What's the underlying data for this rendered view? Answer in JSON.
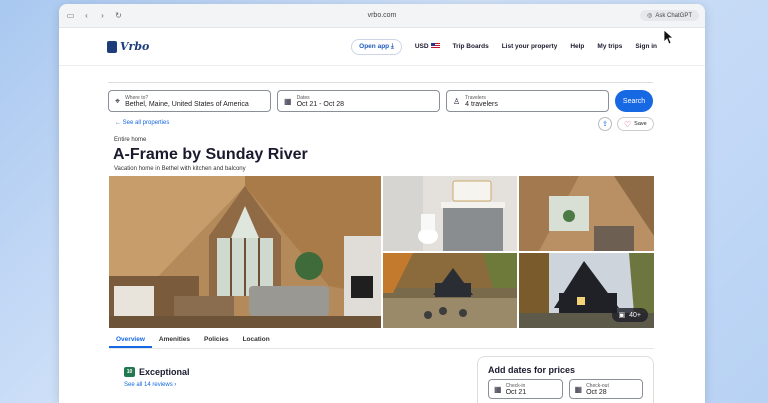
{
  "browser": {
    "url": "vrbo.com",
    "tab_title": "A-Frame by Sunday River",
    "ask_chatgpt": "Ask ChatGPT"
  },
  "nav": {
    "logo": "Vrbo",
    "open_app": "Open app",
    "currency": "USD",
    "trip_boards": "Trip Boards",
    "list_property": "List your property",
    "help": "Help",
    "my_trips": "My trips",
    "sign_in": "Sign in"
  },
  "search": {
    "where_label": "Where to?",
    "where_value": "Bethel, Maine, United States of America",
    "dates_label": "Dates",
    "dates_value": "Oct 21 - Oct 28",
    "travelers_label": "Travelers",
    "travelers_value": "4 travelers",
    "button": "Search"
  },
  "listing": {
    "see_all": "See all properties",
    "save": "Save",
    "type": "Entire home",
    "title": "A-Frame by Sunday River",
    "subtitle": "Vacation home in Bethel with kitchen and balcony",
    "photo_count": "40+"
  },
  "tabs": [
    "Overview",
    "Amenities",
    "Policies",
    "Location"
  ],
  "rating": {
    "score": "10",
    "label": "Exceptional",
    "reviews": "See all 14 reviews"
  },
  "price_card": {
    "heading": "Add dates for prices",
    "checkin_label": "Check-in",
    "checkin_value": "Oct 21",
    "checkout_label": "Check-out",
    "checkout_value": "Oct 28"
  },
  "colors": {
    "brand": "#1d3e7a",
    "accent": "#1668e3",
    "rating": "#227950"
  }
}
